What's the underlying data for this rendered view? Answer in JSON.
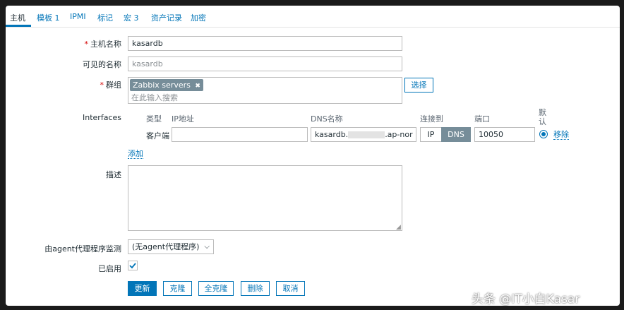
{
  "tabs": [
    {
      "label": "主机"
    },
    {
      "label": "模板 1"
    },
    {
      "label": "IPMI"
    },
    {
      "label": "标记"
    },
    {
      "label": "宏 3"
    },
    {
      "label": "资产记录"
    },
    {
      "label": "加密"
    }
  ],
  "form": {
    "required_mark": "*",
    "host_name": {
      "label": "主机名称",
      "value": "kasardb"
    },
    "visible_name": {
      "label": "可见的名称",
      "placeholder": "kasardb"
    },
    "groups": {
      "label": "群组",
      "tag": "Zabbix servers",
      "remove_glyph": "✖",
      "placeholder": "在此输入搜索",
      "select_button": "选择"
    },
    "interfaces": {
      "label": "Interfaces",
      "headers": {
        "type": "类型",
        "ip": "IP地址",
        "dns": "DNS名称",
        "connect": "连接到",
        "port": "端口",
        "default": "默认"
      },
      "rows": [
        {
          "type": "客户端",
          "ip": "",
          "dns_prefix": "kasardb.",
          "dns_suffix": ".ap-nor",
          "connect_ip": "IP",
          "connect_dns": "DNS",
          "port": "10050",
          "remove": "移除"
        }
      ],
      "add": "添加"
    },
    "description": {
      "label": "描述",
      "value": ""
    },
    "proxy": {
      "label": "由agent代理程序监测",
      "selected": "(无agent代理程序)"
    },
    "enabled": {
      "label": "已启用",
      "checked": true
    }
  },
  "buttons": {
    "update": "更新",
    "clone": "克隆",
    "full_clone": "全克隆",
    "delete": "删除",
    "cancel": "取消"
  },
  "watermark": "头条 @IT小白Kasar",
  "colors": {
    "accent": "#0275b8",
    "required": "#d40000",
    "tag_bg": "#768d99",
    "frame": "#1b1b1b"
  }
}
